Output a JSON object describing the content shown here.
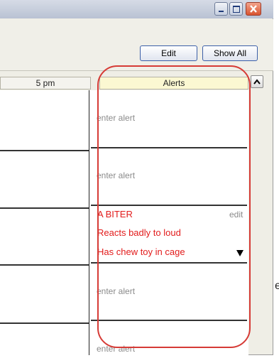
{
  "window": {
    "controls": [
      {
        "name": "minimize-button",
        "icon": "minimize-icon"
      },
      {
        "name": "maximize-button",
        "icon": "maximize-icon"
      },
      {
        "name": "close-button",
        "icon": "close-icon"
      }
    ]
  },
  "toolbar": {
    "edit_label": "Edit",
    "show_all_label": "Show All"
  },
  "columns": {
    "time_label": "5 pm",
    "alerts_label": "Alerts"
  },
  "alerts": [
    {
      "placeholder": "enter alert"
    },
    {
      "placeholder": "enter alert"
    },
    {
      "lines": [
        "A BITER",
        "Reacts badly to loud",
        "Has chew toy in cage"
      ],
      "edit_label": "edit"
    },
    {
      "placeholder": "enter alert"
    },
    {
      "placeholder": "enter alert"
    }
  ],
  "side_text": "e",
  "colors": {
    "alert_text": "#e21b1b",
    "alerts_header_bg": "#fbf8d2",
    "highlight_outline": "#d63b36",
    "close_button": "#d9532f"
  }
}
